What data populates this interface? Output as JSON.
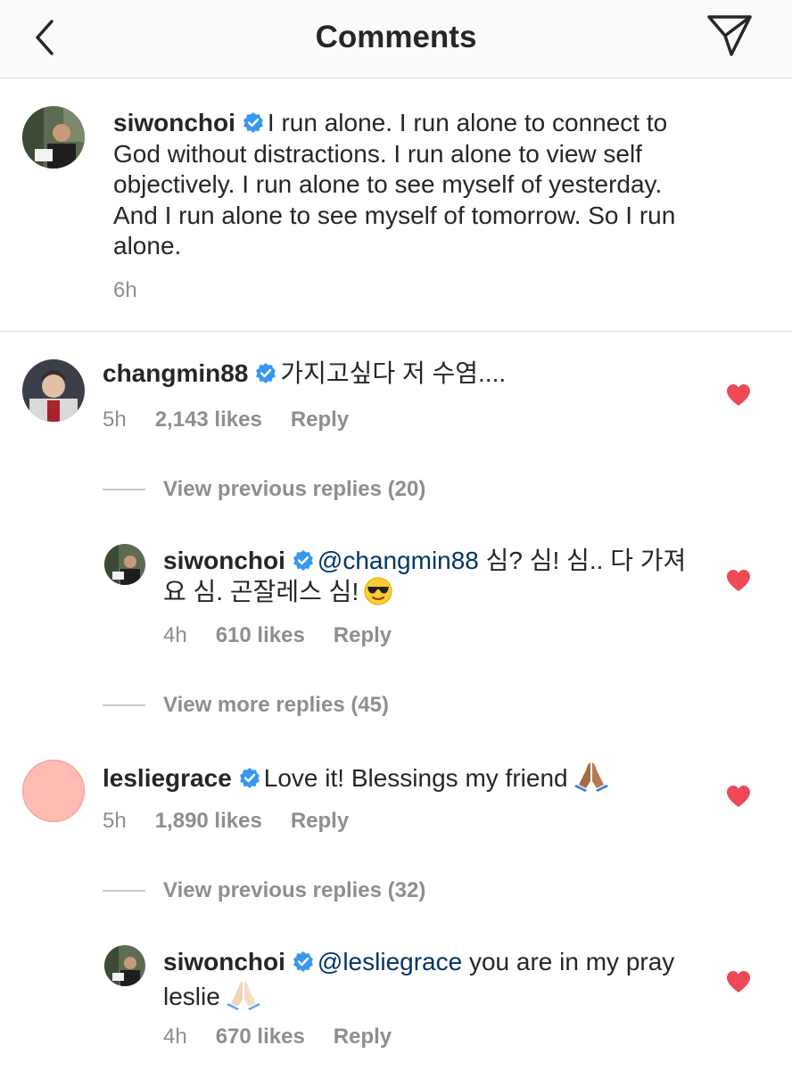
{
  "header": {
    "title": "Comments"
  },
  "caption": {
    "username": "siwonchoi",
    "text": "I run alone. I run alone to connect to God without distractions. I run alone to view self objectively. I run alone to see myself of yesterday. And I run alone to see myself of tomorrow. So I run alone.",
    "time": "6h"
  },
  "comments": [
    {
      "username": "changmin88",
      "text": "가지고싶다 저 수염....",
      "time": "5h",
      "likes": "2,143 likes",
      "reply_label": "Reply",
      "view_replies": "View previous replies (20)",
      "reply": {
        "username": "siwonchoi",
        "mention": "@changmin88",
        "text": "심? 심! 심.. 다 가져요 심. 곤잘레스 심!",
        "emoji": "sunglasses-face",
        "time": "4h",
        "likes": "610 likes",
        "reply_label": "Reply"
      },
      "view_more": "View more replies (45)"
    },
    {
      "username": "lesliegrace",
      "text": "Love it! Blessings my friend",
      "emoji": "folded-hands-medium-dark",
      "time": "5h",
      "likes": "1,890 likes",
      "reply_label": "Reply",
      "view_replies": "View previous replies (32)",
      "reply": {
        "username": "siwonchoi",
        "mention": "@lesliegrace",
        "text": "you are in my pray leslie",
        "emoji": "folded-hands-light",
        "time": "4h",
        "likes": "670 likes",
        "reply_label": "Reply"
      }
    }
  ],
  "colors": {
    "text": "#262626",
    "muted": "#8e8e8e",
    "mention": "#003569",
    "verified": "#3897f0",
    "heart": "#ed4956",
    "divider": "#dbdbdb"
  }
}
